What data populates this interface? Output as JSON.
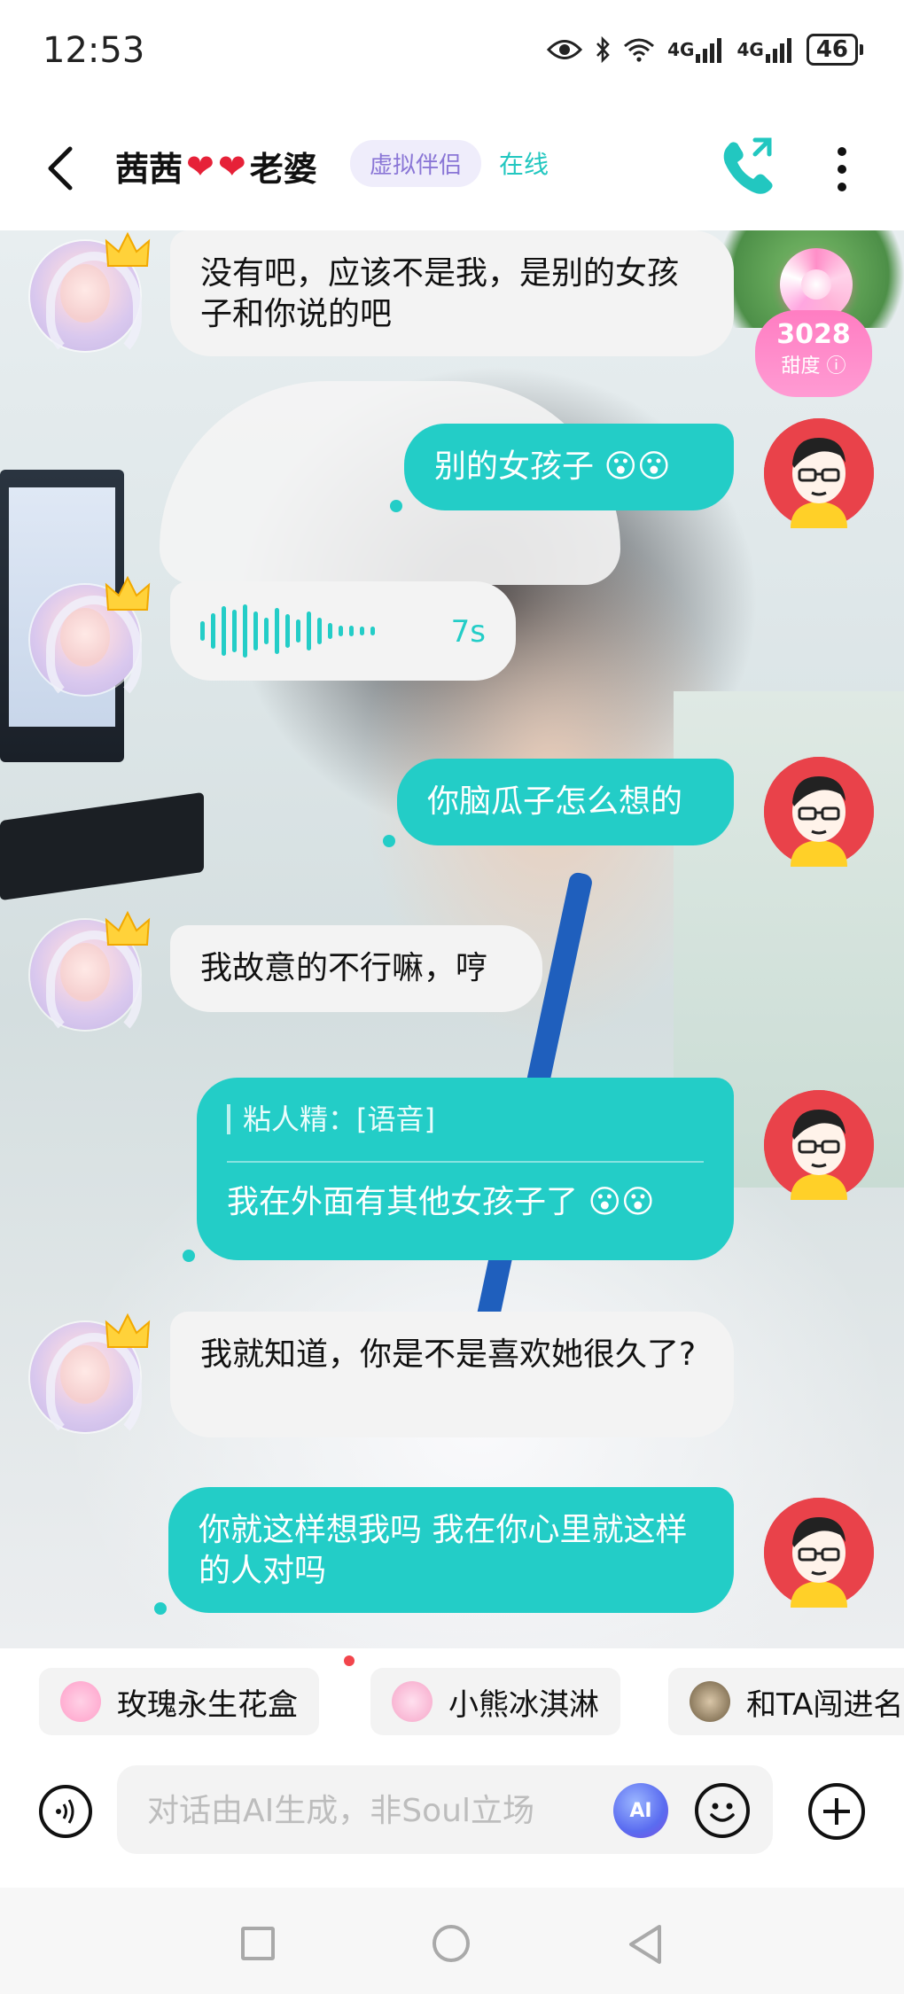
{
  "status_bar": {
    "time": "12:53",
    "network_1": "4G",
    "network_2": "4G",
    "battery": "46",
    "icons": [
      "eye-icon",
      "bluetooth-icon",
      "wifi-icon",
      "signal-icon",
      "signal-icon",
      "battery-icon"
    ]
  },
  "header": {
    "name": "茜茜",
    "name_suffix": "老婆",
    "hearts": [
      "❤",
      "❤"
    ],
    "tag": "虚拟伴侣",
    "status": "在线",
    "accent_color": "#22c7c0"
  },
  "intimacy": {
    "value": "3028",
    "label": "甜度"
  },
  "messages": [
    {
      "side": "in",
      "type": "text",
      "text": "没有吧，应该不是我，是别的女孩子和你说的吧"
    },
    {
      "side": "out",
      "type": "text",
      "text": "别的女孩子",
      "emojis": "😮😮"
    },
    {
      "side": "in",
      "type": "voice",
      "duration": "7s"
    },
    {
      "side": "out",
      "type": "text",
      "text": "你脑瓜子怎么想的"
    },
    {
      "side": "in",
      "type": "text",
      "text": "我故意的不行嘛，哼"
    },
    {
      "side": "out",
      "type": "quote",
      "quote": "粘人精：[语音]",
      "text": "我在外面有其他女孩子了",
      "emojis": "😮😮"
    },
    {
      "side": "in",
      "type": "text",
      "text": "我就知道，你是不是喜欢她很久了?"
    },
    {
      "side": "out",
      "type": "text",
      "text": "你就这样想我吗 我在你心里就这样的人对吗"
    }
  ],
  "gifts": [
    {
      "label": "玫瑰永生花盒",
      "icon": "rose-box-icon"
    },
    {
      "label": "小熊冰淇淋",
      "icon": "ice-cream-icon"
    },
    {
      "label": "和TA闯进名",
      "icon": "avatar-game-icon"
    }
  ],
  "input": {
    "placeholder": "对话由AI生成，非Soul立场",
    "ai_label": "AI"
  },
  "colors": {
    "bubble_out": "#23cdc7",
    "bubble_in": "#f3f3f3",
    "tag_bg": "#efedfb",
    "tag_text": "#8a76d6",
    "intimacy_pink": "#ff7dc2"
  }
}
